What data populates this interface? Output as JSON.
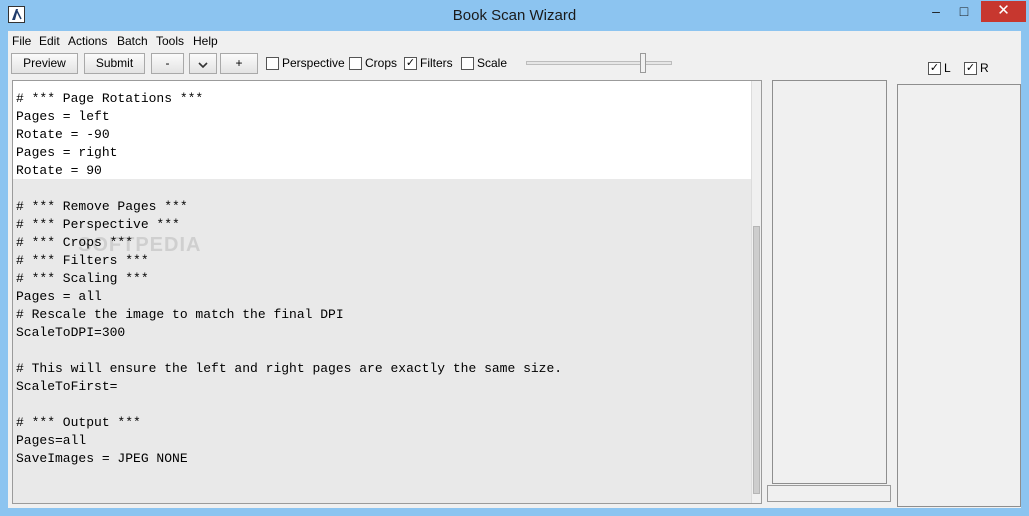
{
  "window": {
    "title": "Book Scan Wizard",
    "minimize": "–",
    "maximize": "□",
    "close": "✕"
  },
  "menu": [
    "File",
    "Edit",
    "Actions",
    "Batch",
    "Tools",
    "Help"
  ],
  "toolbar": {
    "preview": "Preview",
    "submit": "Submit",
    "zoom_out": "-",
    "dropdown": "⌄",
    "zoom_in": "+",
    "checkboxes": [
      {
        "label": "Perspective",
        "checked": false
      },
      {
        "label": "Crops",
        "checked": false
      },
      {
        "label": "Filters",
        "checked": true
      },
      {
        "label": "Scale",
        "checked": false
      }
    ],
    "slider_position": 0.78
  },
  "page_toggles": [
    {
      "label": "L",
      "checked": true
    },
    {
      "label": "R",
      "checked": true
    }
  ],
  "editor": {
    "lines": [
      "# *** Page Rotations ***",
      "Pages = left",
      "Rotate = -90",
      "Pages = right",
      "Rotate = 90",
      "",
      "# *** Remove Pages ***",
      "# *** Perspective ***",
      "# *** Crops ***",
      "# *** Filters ***",
      "# *** Scaling ***",
      "Pages = all",
      "# Rescale the image to match the final DPI",
      "ScaleToDPI=300",
      "",
      "# This will ensure the left and right pages are exactly the same size.",
      "ScaleToFirst=",
      "",
      "# *** Output ***",
      "Pages=all",
      "SaveImages = JPEG NONE"
    ],
    "watermark": "SOFTPEDIA"
  },
  "check_glyph": "✓"
}
